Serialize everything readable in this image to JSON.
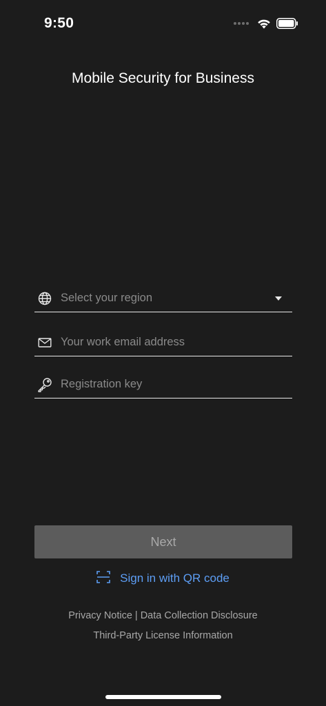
{
  "status_bar": {
    "time": "9:50"
  },
  "app": {
    "title": "Mobile Security for Business"
  },
  "form": {
    "region": {
      "placeholder": "Select your region",
      "icon": "globe-icon"
    },
    "email": {
      "placeholder": "Your work email address",
      "icon": "mail-icon"
    },
    "key": {
      "placeholder": "Registration key",
      "icon": "key-icon"
    }
  },
  "actions": {
    "next_label": "Next",
    "qr_label": "Sign in with QR code"
  },
  "footer": {
    "privacy": "Privacy Notice",
    "separator": "|",
    "data_collection": "Data Collection Disclosure",
    "third_party": "Third-Party License Information"
  },
  "colors": {
    "background": "#1c1c1c",
    "link": "#5d9ef5",
    "button_disabled": "#5c5c5c"
  }
}
